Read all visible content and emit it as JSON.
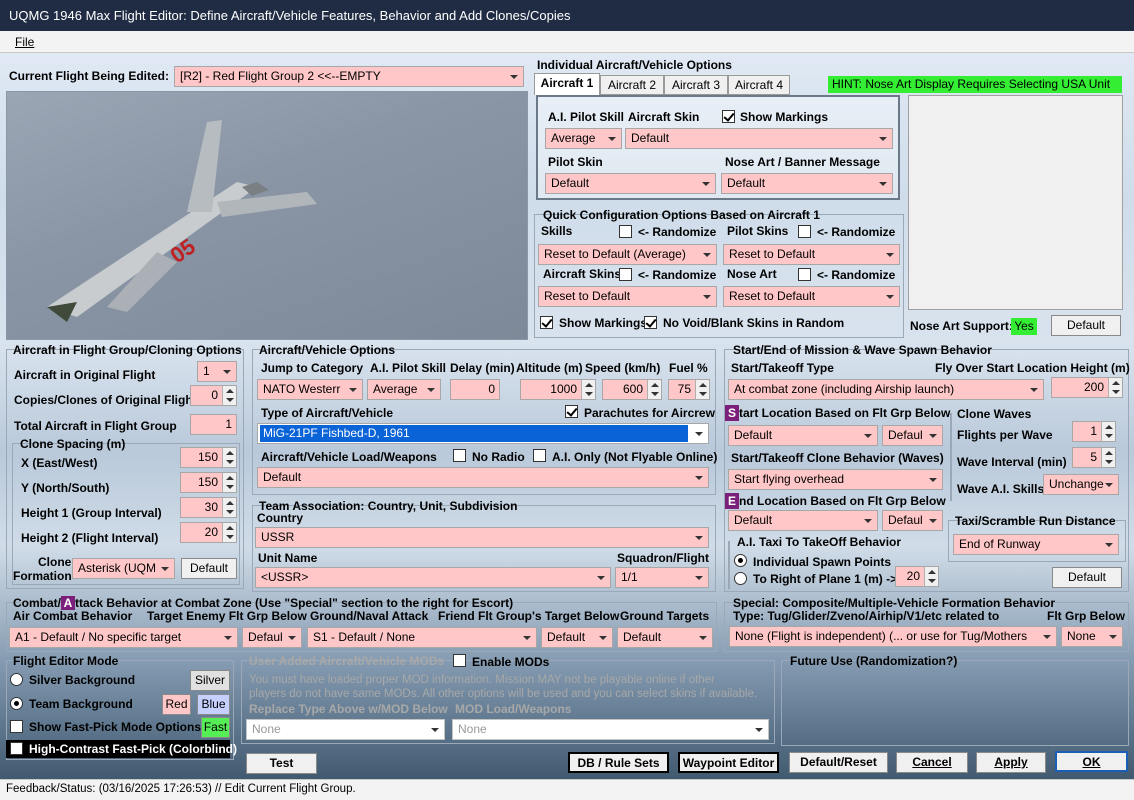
{
  "window": {
    "title": "UQMG 1946 Max Flight Editor:  Define Aircraft/Vehicle Features, Behavior and Add Clones/Copies"
  },
  "menu": {
    "file": "File"
  },
  "flight_select": {
    "label": "Current Flight Being Edited:",
    "value": "[R2] -  Red Flight Group  2     <<--EMPTY"
  },
  "individual": {
    "title": "Individual Aircraft/Vehicle Options",
    "tabs": [
      "Aircraft 1",
      "Aircraft 2",
      "Aircraft 3",
      "Aircraft 4"
    ],
    "hint": "HINT:  Nose Art Display Requires Selecting USA Unit",
    "ai_pilot_skill_label": "A.I. Pilot Skill",
    "ai_pilot_skill_value": "Average",
    "aircraft_skin_label": "Aircraft Skin",
    "aircraft_skin_value": "Default",
    "show_markings": "Show Markings",
    "pilot_skin_label": "Pilot Skin",
    "pilot_skin_value": "Default",
    "nose_art_label": "Nose Art / Banner Message",
    "nose_art_value": "Default"
  },
  "quick": {
    "title": "Quick Configuration Options Based on Aircraft 1",
    "skills_label": "Skills",
    "randomize": "<- Randomize",
    "skills_value": "Reset to Default (Average)",
    "pilot_skins_label": "Pilot Skins",
    "pilot_skins_value": "Reset to Default",
    "aircraft_skins_label": "Aircraft Skins",
    "aircraft_skins_value": "Reset to Default",
    "nose_art_label": "Nose Art",
    "nose_art_value": "Reset to Default",
    "show_markings": "Show Markings",
    "no_void": "No Void/Blank Skins in Random"
  },
  "nose_art_support": {
    "label": "Nose Art Support:",
    "value": "Yes",
    "default_btn": "Default"
  },
  "cloning": {
    "title": "Aircraft in Flight Group/Cloning Options",
    "orig_label": "Aircraft in Original Flight",
    "orig_value": "1",
    "copies_label": "Copies/Clones of Original Flight",
    "copies_value": "0",
    "total_label": "Total Aircraft in Flight Group",
    "total_value": "1",
    "spacing_title": "Clone Spacing (m)",
    "x_label": "X (East/West)",
    "x_value": "150",
    "y_label": "Y (North/South)",
    "y_value": "150",
    "h1_label": "Height 1 (Group Interval)",
    "h1_value": "30",
    "h2_label": "Height 2 (Flight Interval)",
    "h2_value": "20",
    "formation_label1": "Clone",
    "formation_label2": "Formation",
    "formation_value": "Asterisk (UQM",
    "default_btn": "Default"
  },
  "vehicle": {
    "title": "Aircraft/Vehicle Options",
    "jump_label": "Jump to Category",
    "jump_value": "NATO Westerr",
    "skill_label": "A.I. Pilot Skill",
    "skill_value": "Average",
    "delay_label": "Delay (min)",
    "delay_value": "0",
    "alt_label": "Altitude (m)",
    "alt_value": "1000",
    "speed_label": "Speed (km/h)",
    "speed_value": "600",
    "fuel_label": "Fuel %",
    "fuel_value": "75",
    "type_label": "Type of Aircraft/Vehicle",
    "parachutes": "Parachutes for Aircrew",
    "type_value": "MiG-21PF Fishbed-D, 1961",
    "load_label": "Aircraft/Vehicle Load/Weapons",
    "no_radio": "No Radio",
    "ai_only": "A.I. Only (Not Flyable Online)",
    "load_value": "Default"
  },
  "team": {
    "title": "Team Association:  Country, Unit, Subdivision",
    "country_label": "Country",
    "country_value": "USSR",
    "unit_label": "Unit Name",
    "unit_value": "<USSR>",
    "squadron_label": "Squadron/Flight",
    "squadron_value": "1/1"
  },
  "mission": {
    "title": "Start/End of Mission & Wave Spawn Behavior",
    "start_type_label": "Start/Takeoff Type",
    "start_type_value": "At combat zone (including Airship launch)",
    "fly_over_label": "Fly Over Start Location Height (m)",
    "fly_over_value": "200",
    "start_loc_badge": "S",
    "start_loc_label": "tart Location Based on Flt Grp Below",
    "start_loc_value": "Default",
    "start_loc_value2": "Defaul",
    "clone_behavior_label": "Start/Takeoff Clone Behavior (Waves)",
    "clone_behavior_value": "Start flying overhead",
    "end_loc_badge": "E",
    "end_loc_label": "nd Location Based on Flt Grp Below",
    "end_loc_value": "Default",
    "end_loc_value2": "Defaul",
    "taxi_title": "A.I. Taxi To TakeOff Behavior",
    "taxi_opt1": "Individual Spawn Points",
    "taxi_opt2": "To Right of Plane 1 (m) ->",
    "taxi_value": "20",
    "waves_title": "Clone Waves",
    "fpw_label": "Flights per Wave",
    "fpw_value": "1",
    "wi_label": "Wave Interval (min)",
    "wi_value": "5",
    "wai_label": "Wave A.I. Skills",
    "wai_value": "Unchange",
    "scramble_title": "Taxi/Scramble Run Distance",
    "scramble_value": "End of Runway",
    "default_btn": "Default"
  },
  "combat": {
    "title_pre": "Combat/",
    "title_badge": "A",
    "title_post": "ttack Behavior at Combat Zone (Use \"Special\" section to the right for Escort)",
    "air_label": "Air Combat Behavior",
    "air_value": "A1 - Default / No specific target",
    "target_label": "Target Enemy Flt Grp Below",
    "target_value": "Defaul",
    "ground_label": "Ground/Naval Attack",
    "ground_value": "S1 - Default / None",
    "friend_label": "Friend Flt Group's Target Below",
    "friend_value": "Default",
    "gt_label": "Ground Targets",
    "gt_value": "Default"
  },
  "special": {
    "title": "Special: Composite/Multiple-Vehicle Formation Behavior",
    "type_label": "Type: Tug/Glider/Zveno/Airhip/V1/etc related to",
    "flt_label": "Flt Grp Below",
    "type_value": "None (Flight is independent) (... or use for Tug/Mothers",
    "flt_value": "None"
  },
  "mode": {
    "title": "Flight Editor Mode",
    "silver_label": "Silver Background",
    "silver_btn": "Silver",
    "team_label": "Team Background",
    "red_btn": "Red",
    "blue_btn": "Blue",
    "fast_label": "Show Fast-Pick Mode Options",
    "fast_btn": "Fast",
    "contrast_label": "High-Contrast Fast-Pick (Colorblind)"
  },
  "mods": {
    "title": "User Added Aircraft/Vehicle MODs",
    "enable": "Enable MODs",
    "warn1": "You must have loaded proper MOD information.  Mission MAY not be playable online if other",
    "warn2": "players do not have same MODs.  All other options will be used and you can select skins if available.",
    "replace_label": "Replace Type Above w/MOD Below",
    "load_label": "MOD Load/Weapons",
    "replace_value": "None",
    "load_value": "None"
  },
  "future": {
    "title": "Future Use (Randomization?)"
  },
  "buttons": {
    "test": "Test",
    "db": "DB / Rule Sets",
    "waypoint": "Waypoint Editor",
    "default_reset": "Default/Reset",
    "cancel": "Cancel",
    "apply": "Apply",
    "ok": "OK"
  },
  "status": {
    "text": "Feedback/Status:   (03/16/2025 17:26:53) // Edit Current Flight Group."
  },
  "colors": {
    "field_pink": "#ffc7c7",
    "hint_green": "#33ee33",
    "selection_blue": "#0a64d8",
    "badge_purple": "#7a1f7a"
  }
}
